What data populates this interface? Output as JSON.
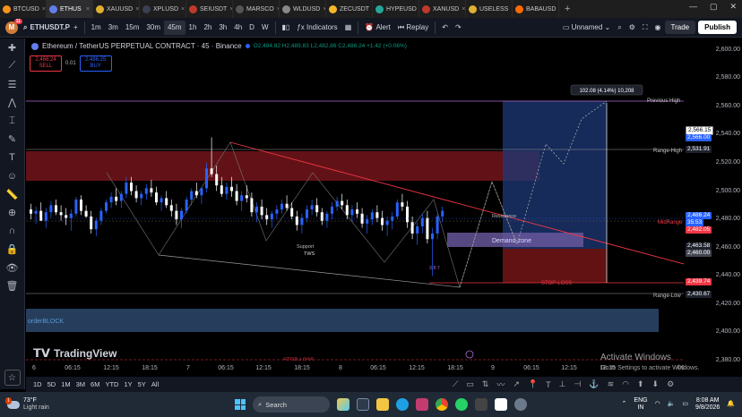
{
  "browser": {
    "tabs": [
      {
        "label": "BTCUSD",
        "color": "#f7931a",
        "active": false
      },
      {
        "label": "ETHUS",
        "color": "#627eea",
        "active": true
      },
      {
        "label": "XAUUSD",
        "color": "#e0b030",
        "active": false
      },
      {
        "label": "XPLUSD",
        "color": "#3a3f52",
        "active": false
      },
      {
        "label": "SEIUSDT",
        "color": "#c0392b",
        "active": false
      },
      {
        "label": "MARSCO",
        "color": "#555",
        "active": false
      },
      {
        "label": "WLDUSD",
        "color": "#888",
        "active": false
      },
      {
        "label": "ZECUSDT",
        "color": "#f4b728",
        "active": false
      },
      {
        "label": "HYPEUSD",
        "color": "#26a69a",
        "active": false
      },
      {
        "label": "XANUSD",
        "color": "#c0392b",
        "active": false
      },
      {
        "label": "USELESS",
        "color": "#e0b030",
        "active": false
      },
      {
        "label": "BABAUSD",
        "color": "#ff6a00",
        "active": false
      }
    ],
    "new_tab": "+",
    "window_controls": [
      "—",
      "▢",
      "✕"
    ]
  },
  "toolbar": {
    "avatar_letter": "M",
    "notif_count": "11",
    "symbol": "ETHUSDT.P",
    "add": "+",
    "intervals": [
      "1m",
      "3m",
      "15m",
      "30m",
      "45m",
      "1h",
      "2h",
      "3h",
      "4h",
      "D",
      "W"
    ],
    "active_interval": "45m",
    "indicators": "Indicators",
    "alert": "Alert",
    "replay": "Replay",
    "layout_name": "Unnamed",
    "trade": "Trade",
    "publish": "Publish"
  },
  "legend": {
    "title": "Ethereum / TetherUS PERPETUAL CONTRACT · 45 · Binance",
    "ohlc": "O2,484.82 H2,489.83 L2,482.86 C2,486.24 +1.42 (+0.06%)",
    "sell_price": "2,486.24",
    "sell_label": "SELL",
    "spread": "0.01",
    "buy_price": "2,486.25",
    "buy_label": "BUY"
  },
  "price_axis": {
    "ticks": [
      "2,600.00",
      "2,580.00",
      "2,560.00",
      "2,540.00",
      "2,520.00",
      "2,500.00",
      "2,480.00",
      "2,460.00",
      "2,440.00",
      "2,420.00",
      "2,400.00",
      "2,380.00"
    ],
    "labels": {
      "previous_high": "2,566.15",
      "previous_high_2": "2,566.00",
      "range_high": "2,531.91",
      "last_price": "2,486.24",
      "countdown": "35:53",
      "midrange": "2,482.05",
      "demand": "2,463.58",
      "demand_2": "2,460.00",
      "stop": "2,439.74",
      "range_low": "2,430.67"
    }
  },
  "annotations": {
    "previous_high": "Previous High",
    "range_high": "Range-High",
    "midrange": "MidRange",
    "range_low": "Range-Low",
    "demand_zone": "Demand-zone",
    "stop_loss": "STOP-LOSS",
    "stop_loss_bottom": "STOP-LOSS",
    "resistance": "Resistance",
    "support": "Support",
    "tws": "TWS",
    "orderblock": "orderBLOCK",
    "measure": "102.08 (4.14%) 10,208",
    "small_label": "3·8·7"
  },
  "time_axis": {
    "ticks": [
      "6",
      "06:15",
      "12:15",
      "18:15",
      "7",
      "06:15",
      "12:15",
      "18:15",
      "8",
      "06:15",
      "12:15",
      "18:15",
      "9",
      "06:15",
      "12:15",
      "18:15",
      "06"
    ]
  },
  "range_bar": {
    "ranges": [
      "1D",
      "5D",
      "1M",
      "3M",
      "6M",
      "YTD",
      "1Y",
      "5Y",
      "All"
    ]
  },
  "watermark": {
    "brand": "TradingView",
    "activate_title": "Activate Windows",
    "activate_sub": "Go to Settings to activate Windows."
  },
  "taskbar": {
    "temp": "73°F",
    "weather": "Light rain",
    "weather_badge": "1",
    "search": "Search",
    "lang": "ENG",
    "region": "IN",
    "time": "8:08 AM",
    "date": "9/8/2026"
  },
  "colors": {
    "bull": "#2962ff",
    "bear": "#ffffff",
    "supply": "#b2202a",
    "target": "#1e3a78",
    "stop": "#8b1a1a",
    "demand": "#6b5aa0"
  },
  "chart_data": {
    "type": "candlestick",
    "ylim": [
      2380,
      2608
    ],
    "candles": [
      [
        2487,
        2491,
        2480,
        2484
      ],
      [
        2484,
        2489,
        2477,
        2486
      ],
      [
        2486,
        2492,
        2480,
        2479
      ],
      [
        2479,
        2488,
        2474,
        2485
      ],
      [
        2485,
        2493,
        2481,
        2490
      ],
      [
        2490,
        2494,
        2483,
        2485
      ],
      [
        2485,
        2490,
        2479,
        2483
      ],
      [
        2483,
        2488,
        2476,
        2481
      ],
      [
        2481,
        2487,
        2472,
        2484
      ],
      [
        2484,
        2496,
        2482,
        2494
      ],
      [
        2494,
        2497,
        2483,
        2486
      ],
      [
        2486,
        2490,
        2481,
        2482
      ],
      [
        2482,
        2486,
        2470,
        2473
      ],
      [
        2473,
        2481,
        2468,
        2479
      ],
      [
        2479,
        2488,
        2476,
        2486
      ],
      [
        2486,
        2494,
        2484,
        2492
      ],
      [
        2492,
        2499,
        2488,
        2496
      ],
      [
        2496,
        2502,
        2490,
        2493
      ],
      [
        2493,
        2500,
        2488,
        2498
      ],
      [
        2498,
        2510,
        2495,
        2506
      ],
      [
        2506,
        2510,
        2497,
        2500
      ],
      [
        2500,
        2504,
        2492,
        2495
      ],
      [
        2495,
        2500,
        2490,
        2498
      ],
      [
        2498,
        2505,
        2494,
        2502
      ],
      [
        2502,
        2508,
        2496,
        2499
      ],
      [
        2499,
        2503,
        2490,
        2492
      ],
      [
        2492,
        2497,
        2486,
        2495
      ],
      [
        2495,
        2500,
        2488,
        2490
      ],
      [
        2490,
        2494,
        2482,
        2486
      ],
      [
        2486,
        2491,
        2476,
        2480
      ],
      [
        2480,
        2488,
        2474,
        2486
      ],
      [
        2486,
        2496,
        2484,
        2494
      ],
      [
        2494,
        2502,
        2490,
        2500
      ],
      [
        2500,
        2506,
        2495,
        2497
      ],
      [
        2497,
        2503,
        2491,
        2502
      ],
      [
        2502,
        2520,
        2499,
        2516
      ],
      [
        2516,
        2538,
        2510,
        2512
      ],
      [
        2512,
        2518,
        2500,
        2504
      ],
      [
        2504,
        2510,
        2496,
        2498
      ],
      [
        2498,
        2506,
        2494,
        2503
      ],
      [
        2503,
        2510,
        2496,
        2500
      ],
      [
        2500,
        2505,
        2490,
        2493
      ],
      [
        2493,
        2500,
        2486,
        2497
      ],
      [
        2497,
        2504,
        2492,
        2495
      ],
      [
        2495,
        2499,
        2482,
        2485
      ],
      [
        2485,
        2492,
        2478,
        2489
      ],
      [
        2489,
        2494,
        2480,
        2483
      ],
      [
        2483,
        2488,
        2476,
        2480
      ],
      [
        2480,
        2486,
        2474,
        2484
      ],
      [
        2484,
        2490,
        2480,
        2487
      ],
      [
        2487,
        2494,
        2484,
        2491
      ],
      [
        2491,
        2497,
        2486,
        2488
      ],
      [
        2488,
        2492,
        2480,
        2482
      ],
      [
        2482,
        2486,
        2472,
        2476
      ],
      [
        2476,
        2484,
        2470,
        2481
      ],
      [
        2481,
        2490,
        2478,
        2487
      ],
      [
        2487,
        2494,
        2483,
        2490
      ],
      [
        2490,
        2495,
        2482,
        2485
      ],
      [
        2485,
        2488,
        2476,
        2479
      ],
      [
        2479,
        2486,
        2474,
        2484
      ],
      [
        2484,
        2492,
        2480,
        2489
      ],
      [
        2489,
        2496,
        2486,
        2493
      ],
      [
        2493,
        2498,
        2487,
        2490
      ],
      [
        2490,
        2494,
        2480,
        2483
      ],
      [
        2483,
        2490,
        2478,
        2487
      ],
      [
        2487,
        2492,
        2481,
        2484
      ],
      [
        2484,
        2488,
        2474,
        2477
      ],
      [
        2477,
        2483,
        2470,
        2480
      ],
      [
        2480,
        2487,
        2476,
        2485
      ],
      [
        2485,
        2490,
        2478,
        2481
      ],
      [
        2481,
        2486,
        2472,
        2476
      ],
      [
        2476,
        2482,
        2468,
        2479
      ],
      [
        2479,
        2485,
        2473,
        2482
      ],
      [
        2482,
        2494,
        2480,
        2492
      ],
      [
        2492,
        2498,
        2486,
        2489
      ],
      [
        2489,
        2493,
        2474,
        2478
      ],
      [
        2478,
        2482,
        2466,
        2470
      ],
      [
        2470,
        2478,
        2462,
        2475
      ],
      [
        2475,
        2484,
        2470,
        2481
      ],
      [
        2481,
        2486,
        2463,
        2466
      ],
      [
        2466,
        2474,
        2440,
        2470
      ],
      [
        2470,
        2484,
        2466,
        2482
      ],
      [
        2482,
        2489,
        2478,
        2486
      ]
    ]
  }
}
